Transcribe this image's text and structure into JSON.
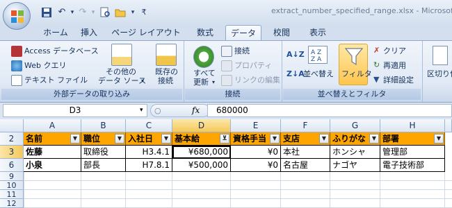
{
  "window": {
    "title": "extract_number_specified_range.xlsx - Microsoft Excel"
  },
  "tabs": [
    "ホーム",
    "挿入",
    "ページ レイアウト",
    "数式",
    "データ",
    "校閲",
    "表示"
  ],
  "active_tab": "データ",
  "ribbon": {
    "external": {
      "access": "Access データベース",
      "web": "Web クエリ",
      "text": "テキスト ファイル",
      "other1": "その他の",
      "other2": "データ ソース",
      "existing1": "既存の",
      "existing2": "接続",
      "label": "外部データの取り込み"
    },
    "connections": {
      "refresh1": "すべて",
      "refresh2": "更新",
      "connect": "接続",
      "properties": "プロパティ",
      "edit_links": "リンクの編集",
      "label": "接続"
    },
    "sortfilter": {
      "sort": "並べ替え",
      "filter": "フィルタ",
      "clear": "クリア",
      "reapply": "再適用",
      "advanced": "詳細設定",
      "label": "並べ替えとフィルタ"
    },
    "data_tools": {
      "text_to_columns": "区切り位置"
    }
  },
  "formula_bar": {
    "name_box": "D3",
    "fx": "fx",
    "value": "680000"
  },
  "columns": [
    "A",
    "B",
    "C",
    "D",
    "E",
    "F",
    "G",
    "H"
  ],
  "rows": [
    "2",
    "3",
    "6",
    "9",
    "10",
    "11",
    "12"
  ],
  "table": {
    "headers": [
      "名前",
      "職位",
      "入社日",
      "基本給",
      "資格手当",
      "支店",
      "ふりがな",
      "部署"
    ],
    "data": [
      [
        "佐藤",
        "取締役",
        "H3.4.1",
        "¥680,000",
        "¥0",
        "本社",
        "ホンシャ",
        "管理部"
      ],
      [
        "小泉",
        "部長",
        "H7.8.1",
        "¥500,000",
        "¥0",
        "名古屋",
        "ナゴヤ",
        "電子技術部"
      ]
    ]
  },
  "colors": {
    "header_fill": "#ffa500",
    "ribbon_bg": "#dbe5f2",
    "active_tab": "#ffffff"
  }
}
